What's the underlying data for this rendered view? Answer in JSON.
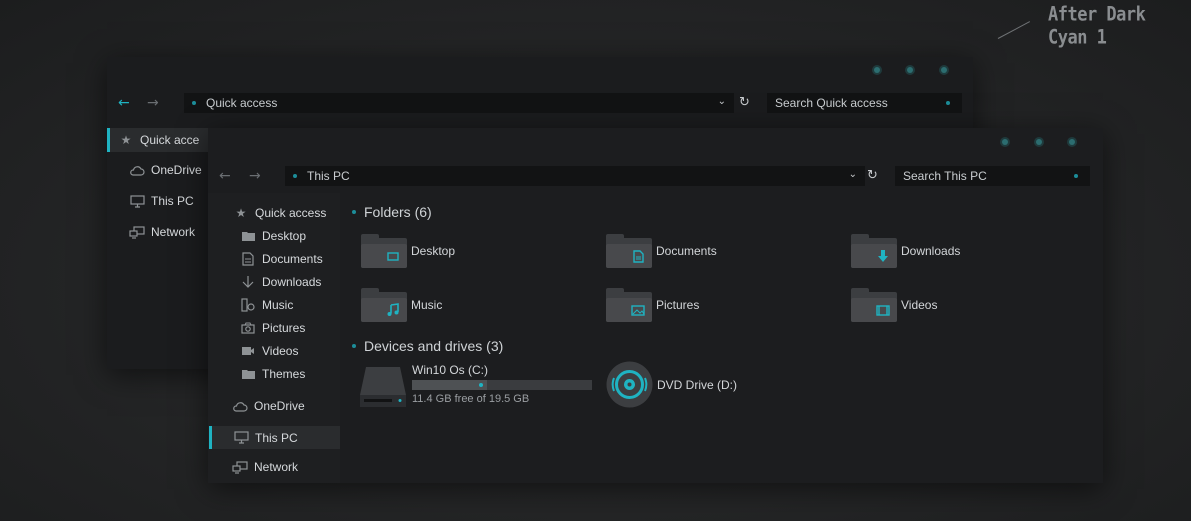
{
  "brand": "After Dark Cyan 1",
  "back_window": {
    "address": "Quick access",
    "search_placeholder": "Search Quick access",
    "sidebar": [
      {
        "label": "Quick acce",
        "icon": "star-icon",
        "selected": true
      },
      {
        "label": "OneDrive",
        "icon": "cloud-icon"
      },
      {
        "label": "This PC",
        "icon": "monitor-icon"
      },
      {
        "label": "Network",
        "icon": "network-icon"
      }
    ]
  },
  "front_window": {
    "address": "This PC",
    "search_placeholder": "Search This PC",
    "sidebar": [
      {
        "label": "Quick access",
        "icon": "star-icon"
      },
      {
        "label": "Desktop",
        "icon": "folder-icon"
      },
      {
        "label": "Documents",
        "icon": "document-icon"
      },
      {
        "label": "Downloads",
        "icon": "download-icon"
      },
      {
        "label": "Music",
        "icon": "music-icon"
      },
      {
        "label": "Pictures",
        "icon": "camera-icon"
      },
      {
        "label": "Videos",
        "icon": "video-icon"
      },
      {
        "label": "Themes",
        "icon": "folder-icon"
      },
      {
        "label": "OneDrive",
        "icon": "cloud-icon"
      },
      {
        "label": "This PC",
        "icon": "monitor-icon",
        "selected": true
      },
      {
        "label": "Network",
        "icon": "network-icon"
      }
    ],
    "folders_title": "Folders (6)",
    "folders": [
      {
        "label": "Desktop",
        "icon": "desktop-icon"
      },
      {
        "label": "Documents",
        "icon": "document-icon"
      },
      {
        "label": "Downloads",
        "icon": "download-icon"
      },
      {
        "label": "Music",
        "icon": "music-icon"
      },
      {
        "label": "Pictures",
        "icon": "pictures-icon"
      },
      {
        "label": "Videos",
        "icon": "video-icon"
      }
    ],
    "drives_title": "Devices and drives (3)",
    "drives": [
      {
        "label": "Win10 Os (C:)",
        "free_text": "11.4 GB free of 19.5 GB",
        "used_fraction": 0.415
      },
      {
        "label": "DVD Drive (D:)"
      }
    ]
  },
  "colors": {
    "accent": "#1fb3c2",
    "accent_dark": "#1c8d99",
    "window": "#1c1d1f"
  }
}
